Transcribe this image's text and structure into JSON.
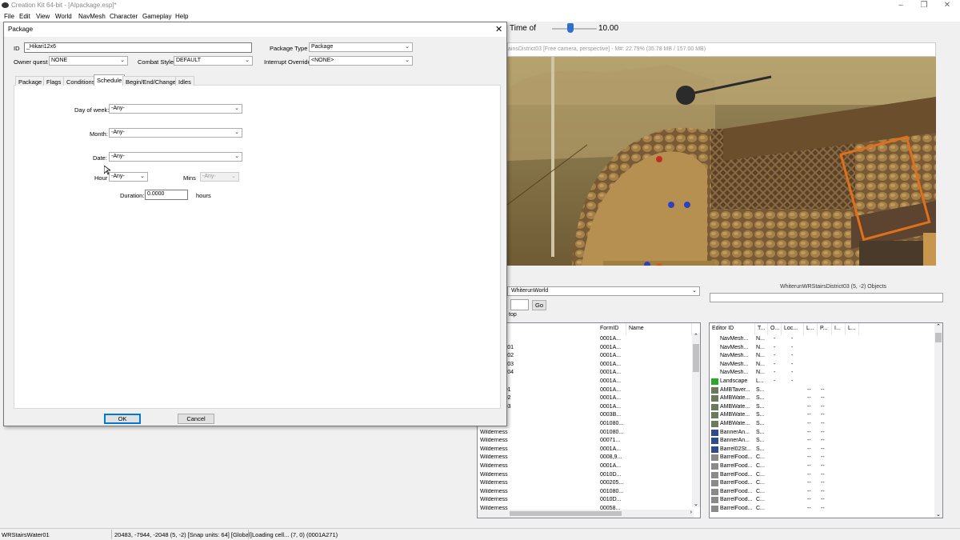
{
  "app": {
    "title": "Creation Kit 64-bit - [AIpackage.esp]*",
    "window_controls": {
      "minimize": "–",
      "maximize": "❐",
      "close": "✕"
    }
  },
  "menu": [
    "File",
    "Edit",
    "View",
    "World",
    "NavMesh",
    "Character",
    "Gameplay",
    "Help"
  ],
  "time_of_day": {
    "label": "Time of",
    "value": "10.00"
  },
  "viewport": {
    "title": "ainsDistrict03 [Free camera, perspective] - M#: 22.79% (35.78 MB / 157.00 MB)"
  },
  "cell_view": {
    "world_dropdown": "WhiterunWorld",
    "location_label": "WhiterunWRStairsDistrict03 (5, -2) Objects",
    "go_button": "Go",
    "top_label": "top",
    "cells_columns": [
      "FormID",
      "Name"
    ],
    "cells_rows": [
      {
        "editor": "gin",
        "formid": "0001A..."
      },
      {
        "editor": "ainsDistrict01",
        "formid": "0001A..."
      },
      {
        "editor": "ainsDistrict02",
        "formid": "0001A..."
      },
      {
        "editor": "ainsDistrict03",
        "formid": "0001A..."
      },
      {
        "editor": "ainsDistrict04",
        "formid": "0001A..."
      },
      {
        "editor": "yforge",
        "formid": "0001A..."
      },
      {
        "editor": "indDistrict01",
        "formid": "0001A..."
      },
      {
        "editor": "indDistrict02",
        "formid": "0001A..."
      },
      {
        "editor": "indDistrict03",
        "formid": "0001A..."
      },
      {
        "editor": "",
        "formid": "0003B..."
      },
      {
        "editor": "",
        "formid": "001080..."
      },
      {
        "editor": "Wilderness",
        "formid": "001080..."
      },
      {
        "editor": "Wilderness",
        "formid": "00071..."
      },
      {
        "editor": "Wilderness",
        "formid": "0001A..."
      },
      {
        "editor": "Wilderness",
        "formid": "0008,9..."
      },
      {
        "editor": "Wilderness",
        "formid": "0001A..."
      },
      {
        "editor": "Wilderness",
        "formid": "0010D..."
      },
      {
        "editor": "Wilderness",
        "formid": "000205..."
      },
      {
        "editor": "Wilderness",
        "formid": "001080..."
      },
      {
        "editor": "Wilderness",
        "formid": "0010D..."
      },
      {
        "editor": "Wilderness",
        "formid": "00058..."
      }
    ],
    "objects_columns": [
      "Editor ID",
      "T...",
      "O...",
      "Loc...",
      "L...",
      "P...",
      "I...",
      "L..."
    ],
    "objects_rows": [
      {
        "id": "NavMesh...",
        "t": "N...",
        "o": "-",
        "loc": "-",
        "l": "",
        "p": "",
        "icon": "none"
      },
      {
        "id": "NavMesh...",
        "t": "N...",
        "o": "-",
        "loc": "-",
        "l": "",
        "p": "",
        "icon": "none"
      },
      {
        "id": "NavMesh...",
        "t": "N...",
        "o": "-",
        "loc": "-",
        "l": "",
        "p": "",
        "icon": "none"
      },
      {
        "id": "NavMesh...",
        "t": "N...",
        "o": "-",
        "loc": "-",
        "l": "",
        "p": "",
        "icon": "none"
      },
      {
        "id": "NavMesh...",
        "t": "N...",
        "o": "-",
        "loc": "-",
        "l": "",
        "p": "",
        "icon": "none"
      },
      {
        "id": "Landscape",
        "t": "L...",
        "o": "-",
        "loc": "-",
        "l": "",
        "p": "",
        "icon": "land"
      },
      {
        "id": "AMBTaver...",
        "t": "S...",
        "o": "",
        "loc": "",
        "l": "--",
        "p": "--",
        "icon": "sound"
      },
      {
        "id": "AMBWate...",
        "t": "S...",
        "o": "",
        "loc": "",
        "l": "--",
        "p": "--",
        "icon": "sound"
      },
      {
        "id": "AMBWate...",
        "t": "S...",
        "o": "",
        "loc": "",
        "l": "--",
        "p": "--",
        "icon": "sound"
      },
      {
        "id": "AMBWate...",
        "t": "S...",
        "o": "",
        "loc": "",
        "l": "--",
        "p": "--",
        "icon": "sound"
      },
      {
        "id": "AMBWate...",
        "t": "S...",
        "o": "",
        "loc": "",
        "l": "--",
        "p": "--",
        "icon": "sound"
      },
      {
        "id": "BannerAn...",
        "t": "S...",
        "o": "",
        "loc": "",
        "l": "--",
        "p": "--",
        "icon": "banner"
      },
      {
        "id": "BannerAn...",
        "t": "S...",
        "o": "",
        "loc": "",
        "l": "--",
        "p": "--",
        "icon": "banner"
      },
      {
        "id": "Barrel02St...",
        "t": "S...",
        "o": "",
        "loc": "",
        "l": "--",
        "p": "--",
        "icon": "banner"
      },
      {
        "id": "BarrelFood...",
        "t": "C...",
        "o": "",
        "loc": "",
        "l": "--",
        "p": "--",
        "icon": "barrel"
      },
      {
        "id": "BarrelFood...",
        "t": "C...",
        "o": "",
        "loc": "",
        "l": "--",
        "p": "--",
        "icon": "barrel"
      },
      {
        "id": "BarrelFood...",
        "t": "C...",
        "o": "",
        "loc": "",
        "l": "--",
        "p": "--",
        "icon": "barrel"
      },
      {
        "id": "BarrelFood...",
        "t": "C...",
        "o": "",
        "loc": "",
        "l": "--",
        "p": "--",
        "icon": "barrel"
      },
      {
        "id": "BarrelFood...",
        "t": "C...",
        "o": "",
        "loc": "",
        "l": "--",
        "p": "--",
        "icon": "barrel"
      },
      {
        "id": "BarrelFood...",
        "t": "C...",
        "o": "",
        "loc": "",
        "l": "--",
        "p": "--",
        "icon": "barrel"
      },
      {
        "id": "BarrelFood...",
        "t": "C...",
        "o": "",
        "loc": "",
        "l": "--",
        "p": "--",
        "icon": "barrel"
      }
    ]
  },
  "dialog": {
    "title": "Package",
    "close": "✕",
    "id_label": "ID",
    "id_value": "_Hikari12x6",
    "package_type_label": "Package Type",
    "package_type_value": "Package",
    "owner_quest_label": "Owner quest",
    "owner_quest_value": "NONE",
    "combat_style_label": "Combat Style",
    "combat_style_value": "DEFAULT",
    "interrupt_override_label": "Interrupt Override",
    "interrupt_override_value": "<NONE>",
    "tabs": [
      "Package",
      "Flags",
      "Conditions",
      "Schedule",
      "Begin/End/Change",
      "Idles"
    ],
    "active_tab": "Schedule",
    "schedule": {
      "day_of_week_label": "Day of week:",
      "day_of_week_value": "-Any-",
      "month_label": "Month:",
      "month_value": "-Any-",
      "date_label": "Date:",
      "date_value": "-Any-",
      "hour_label": "Hour",
      "hour_value": "-Any-",
      "mins_label": "Mins",
      "mins_value": "-Any-",
      "duration_label": "Duration:",
      "duration_value": "0.0000",
      "hours_label": "hours"
    },
    "ok_label": "OK",
    "cancel_label": "Cancel"
  },
  "status_bar": {
    "cell": "WRStairsWater01",
    "coords": "20483, -7944, -2048 (5, -2) [Snap units: 64] [Global]",
    "message": "Loading cell... (7, 0) (0001A271)"
  },
  "colors": {
    "accent": "#0078d7",
    "slider": "#2d6fd1"
  }
}
